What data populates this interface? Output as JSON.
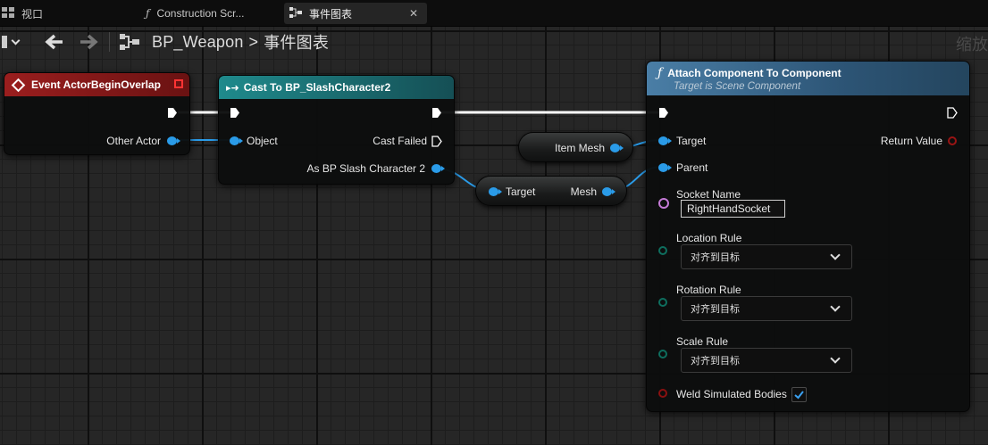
{
  "tabs": [
    {
      "label": "视口",
      "icon": "viewport-grid-icon"
    },
    {
      "label": "Construction Scr...",
      "icon": "function-icon"
    },
    {
      "label": "事件图表",
      "icon": "event-graph-icon",
      "close": "✕"
    }
  ],
  "toolbar": {
    "breadcrumb_root": "BP_Weapon",
    "breadcrumb_sep": ">",
    "breadcrumb_current": "事件图表",
    "zoom_label": "缩放"
  },
  "nodes": {
    "event_begin_overlap": {
      "title": "Event ActorBeginOverlap",
      "pin_other_actor": "Other Actor",
      "header_color": "#8a1a1a"
    },
    "cast": {
      "title": "Cast To BP_SlashCharacter2",
      "pin_object": "Object",
      "pin_cast_failed": "Cast Failed",
      "pin_as": "As BP Slash Character 2",
      "header_color": "#1e6f72"
    },
    "item_mesh": {
      "label": "Item Mesh"
    },
    "get_mesh": {
      "pin_target": "Target",
      "pin_mesh": "Mesh"
    },
    "attach": {
      "title": "Attach Component To Component",
      "subtitle": "Target is Scene Component",
      "header_color": "#3f6f96",
      "pin_target": "Target",
      "pin_parent": "Parent",
      "pin_return": "Return Value",
      "socket_label": "Socket Name",
      "socket_value": "RightHandSocket",
      "location_rule_label": "Location Rule",
      "location_rule_value": "对齐到目标",
      "rotation_rule_label": "Rotation Rule",
      "rotation_rule_value": "对齐到目标",
      "scale_rule_label": "Scale Rule",
      "scale_rule_value": "对齐到目标",
      "weld_label": "Weld Simulated Bodies",
      "weld_checked": true
    }
  },
  "colors": {
    "object_pin": "#2a9be8",
    "name_pin": "#c47ad6",
    "enum_pin": "#0e6e5e",
    "bool_pin": "#8a1010",
    "check": "#3aa0f0"
  }
}
